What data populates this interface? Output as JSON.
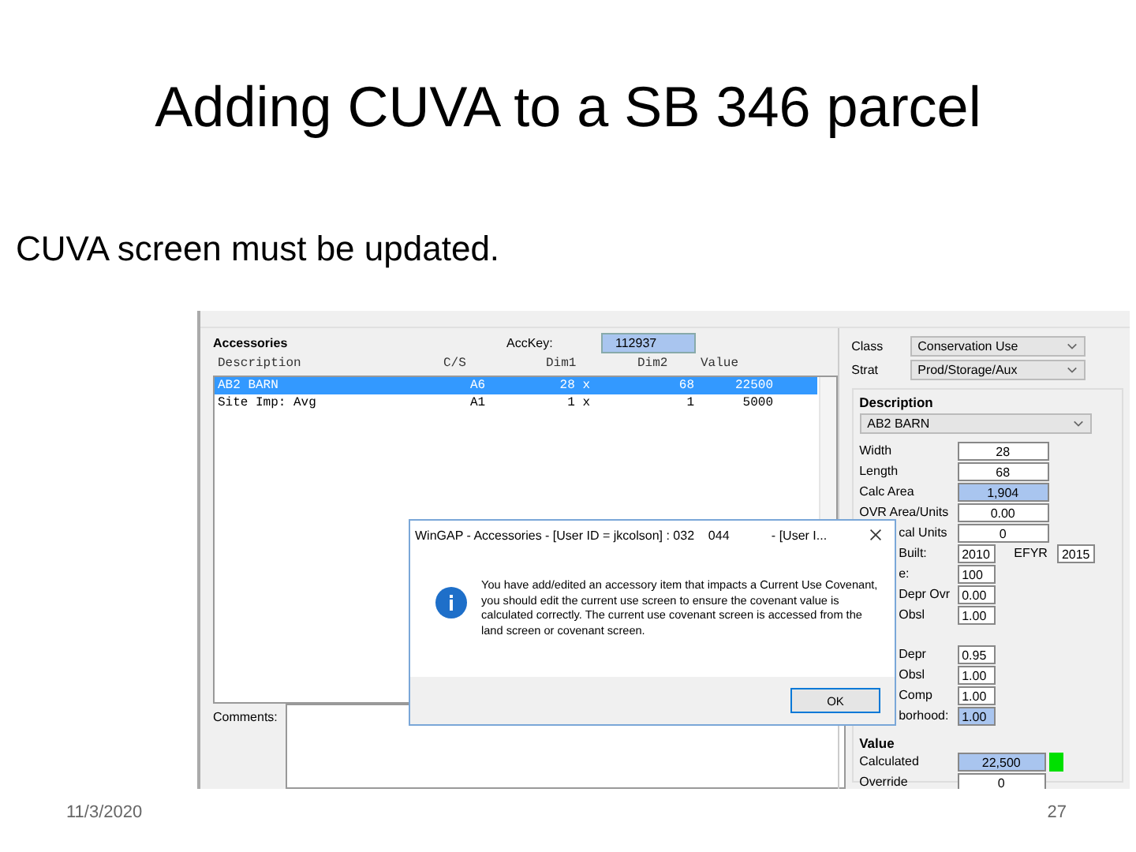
{
  "slide": {
    "title": "Adding CUVA to a SB 346 parcel",
    "subtitle": "CUVA screen must be updated.",
    "date": "11/3/2020",
    "page": "27"
  },
  "accessories": {
    "title": "Accessories",
    "acckey_label": "AccKey:",
    "acckey": "112937",
    "columns": [
      "Description",
      "C/S",
      "Dim1",
      "Dim2",
      "Value"
    ],
    "rows": [
      {
        "cells": [
          "AB2 BARN",
          "A6",
          "28 x",
          "68",
          "22500"
        ],
        "selected": true
      },
      {
        "cells": [
          "Site Imp: Avg",
          "A1",
          "1 x",
          "1",
          "5000"
        ],
        "selected": false
      }
    ],
    "comments_label": "Comments:"
  },
  "details": {
    "class_label": "Class",
    "class": "Conservation Use",
    "strat_label": "Strat",
    "strat": "Prod/Storage/Aux",
    "description_title": "Description",
    "description": "AB2 BARN",
    "groups": [
      [
        {
          "label": "Width",
          "value": "28",
          "highlighted": false
        },
        {
          "label": "Length",
          "value": "68",
          "highlighted": false
        },
        {
          "label": "Calc Area",
          "value": "1,904",
          "highlighted": true
        },
        {
          "label": "OVR Area/Units",
          "value": "0.00",
          "highlighted": false
        },
        {
          "label": "cal Units",
          "value": "0",
          "highlighted": false
        },
        {
          "label": "Built:",
          "value": "2010",
          "highlighted": false,
          "extra_label": "EFYR",
          "extra_value": "2015"
        },
        {
          "label": "e:",
          "value": "100",
          "highlighted": false
        },
        {
          "label": "Depr Ovr",
          "value": "0.00",
          "highlighted": false
        },
        {
          "label": "Obsl",
          "value": "1.00",
          "highlighted": false
        }
      ],
      [
        {
          "label": "Depr",
          "value": "0.95",
          "highlighted": false
        },
        {
          "label": "Obsl",
          "value": "1.00",
          "highlighted": false
        },
        {
          "label": "Comp",
          "value": "1.00",
          "highlighted": false
        },
        {
          "label": "borhood:",
          "value": "1.00",
          "highlighted": true
        }
      ]
    ],
    "value_title": "Value",
    "calculated_label": "Calculated",
    "calculated": "22,500",
    "override_label": "Override",
    "override": "0"
  },
  "dialog": {
    "title": "WinGAP - Accessories - [User ID = jkcolson] : 032    044            - [User I...",
    "message": "You have add/edited an accessory item that impacts a Current Use Covenant, you should edit the current use screen to ensure the covenant value is calculated correctly. The current use covenant screen is accessed from the land screen or covenant screen.",
    "button": "OK"
  }
}
